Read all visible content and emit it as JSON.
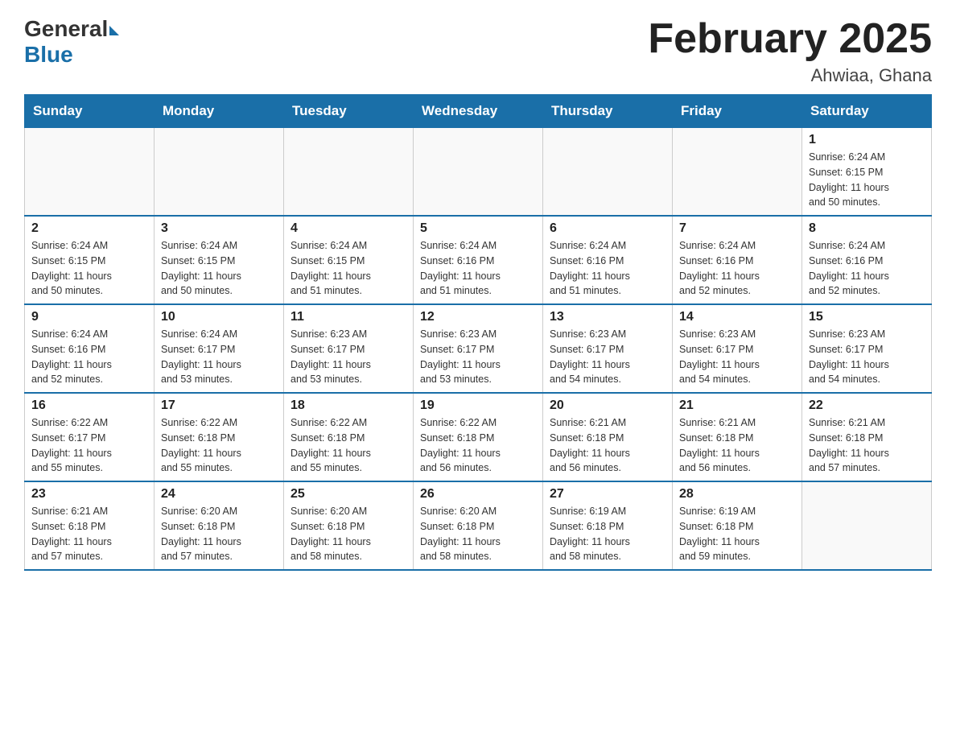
{
  "header": {
    "logo_general": "General",
    "logo_blue": "Blue",
    "title": "February 2025",
    "subtitle": "Ahwiaa, Ghana"
  },
  "days_of_week": [
    "Sunday",
    "Monday",
    "Tuesday",
    "Wednesday",
    "Thursday",
    "Friday",
    "Saturday"
  ],
  "weeks": [
    {
      "days": [
        {
          "number": "",
          "info": ""
        },
        {
          "number": "",
          "info": ""
        },
        {
          "number": "",
          "info": ""
        },
        {
          "number": "",
          "info": ""
        },
        {
          "number": "",
          "info": ""
        },
        {
          "number": "",
          "info": ""
        },
        {
          "number": "1",
          "info": "Sunrise: 6:24 AM\nSunset: 6:15 PM\nDaylight: 11 hours\nand 50 minutes."
        }
      ]
    },
    {
      "days": [
        {
          "number": "2",
          "info": "Sunrise: 6:24 AM\nSunset: 6:15 PM\nDaylight: 11 hours\nand 50 minutes."
        },
        {
          "number": "3",
          "info": "Sunrise: 6:24 AM\nSunset: 6:15 PM\nDaylight: 11 hours\nand 50 minutes."
        },
        {
          "number": "4",
          "info": "Sunrise: 6:24 AM\nSunset: 6:15 PM\nDaylight: 11 hours\nand 51 minutes."
        },
        {
          "number": "5",
          "info": "Sunrise: 6:24 AM\nSunset: 6:16 PM\nDaylight: 11 hours\nand 51 minutes."
        },
        {
          "number": "6",
          "info": "Sunrise: 6:24 AM\nSunset: 6:16 PM\nDaylight: 11 hours\nand 51 minutes."
        },
        {
          "number": "7",
          "info": "Sunrise: 6:24 AM\nSunset: 6:16 PM\nDaylight: 11 hours\nand 52 minutes."
        },
        {
          "number": "8",
          "info": "Sunrise: 6:24 AM\nSunset: 6:16 PM\nDaylight: 11 hours\nand 52 minutes."
        }
      ]
    },
    {
      "days": [
        {
          "number": "9",
          "info": "Sunrise: 6:24 AM\nSunset: 6:16 PM\nDaylight: 11 hours\nand 52 minutes."
        },
        {
          "number": "10",
          "info": "Sunrise: 6:24 AM\nSunset: 6:17 PM\nDaylight: 11 hours\nand 53 minutes."
        },
        {
          "number": "11",
          "info": "Sunrise: 6:23 AM\nSunset: 6:17 PM\nDaylight: 11 hours\nand 53 minutes."
        },
        {
          "number": "12",
          "info": "Sunrise: 6:23 AM\nSunset: 6:17 PM\nDaylight: 11 hours\nand 53 minutes."
        },
        {
          "number": "13",
          "info": "Sunrise: 6:23 AM\nSunset: 6:17 PM\nDaylight: 11 hours\nand 54 minutes."
        },
        {
          "number": "14",
          "info": "Sunrise: 6:23 AM\nSunset: 6:17 PM\nDaylight: 11 hours\nand 54 minutes."
        },
        {
          "number": "15",
          "info": "Sunrise: 6:23 AM\nSunset: 6:17 PM\nDaylight: 11 hours\nand 54 minutes."
        }
      ]
    },
    {
      "days": [
        {
          "number": "16",
          "info": "Sunrise: 6:22 AM\nSunset: 6:17 PM\nDaylight: 11 hours\nand 55 minutes."
        },
        {
          "number": "17",
          "info": "Sunrise: 6:22 AM\nSunset: 6:18 PM\nDaylight: 11 hours\nand 55 minutes."
        },
        {
          "number": "18",
          "info": "Sunrise: 6:22 AM\nSunset: 6:18 PM\nDaylight: 11 hours\nand 55 minutes."
        },
        {
          "number": "19",
          "info": "Sunrise: 6:22 AM\nSunset: 6:18 PM\nDaylight: 11 hours\nand 56 minutes."
        },
        {
          "number": "20",
          "info": "Sunrise: 6:21 AM\nSunset: 6:18 PM\nDaylight: 11 hours\nand 56 minutes."
        },
        {
          "number": "21",
          "info": "Sunrise: 6:21 AM\nSunset: 6:18 PM\nDaylight: 11 hours\nand 56 minutes."
        },
        {
          "number": "22",
          "info": "Sunrise: 6:21 AM\nSunset: 6:18 PM\nDaylight: 11 hours\nand 57 minutes."
        }
      ]
    },
    {
      "days": [
        {
          "number": "23",
          "info": "Sunrise: 6:21 AM\nSunset: 6:18 PM\nDaylight: 11 hours\nand 57 minutes."
        },
        {
          "number": "24",
          "info": "Sunrise: 6:20 AM\nSunset: 6:18 PM\nDaylight: 11 hours\nand 57 minutes."
        },
        {
          "number": "25",
          "info": "Sunrise: 6:20 AM\nSunset: 6:18 PM\nDaylight: 11 hours\nand 58 minutes."
        },
        {
          "number": "26",
          "info": "Sunrise: 6:20 AM\nSunset: 6:18 PM\nDaylight: 11 hours\nand 58 minutes."
        },
        {
          "number": "27",
          "info": "Sunrise: 6:19 AM\nSunset: 6:18 PM\nDaylight: 11 hours\nand 58 minutes."
        },
        {
          "number": "28",
          "info": "Sunrise: 6:19 AM\nSunset: 6:18 PM\nDaylight: 11 hours\nand 59 minutes."
        },
        {
          "number": "",
          "info": ""
        }
      ]
    }
  ]
}
